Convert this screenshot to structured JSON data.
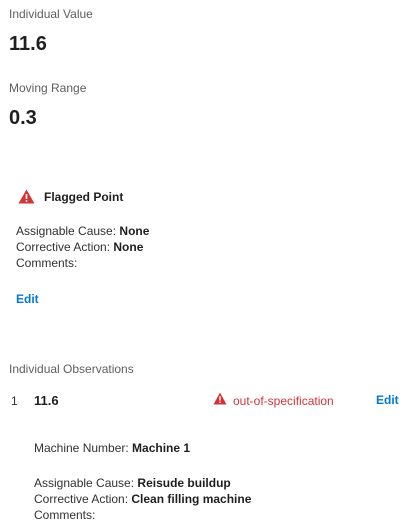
{
  "summary": {
    "individual_value_label": "Individual Value",
    "individual_value": "11.6",
    "moving_range_label": "Moving Range",
    "moving_range": "0.3"
  },
  "flagged": {
    "title": "Flagged Point",
    "icon": "warning-icon",
    "assignable_cause_label": "Assignable Cause: ",
    "assignable_cause": "None",
    "corrective_action_label": "Corrective Action: ",
    "corrective_action": "None",
    "comments_label": "Comments:",
    "edit_label": "Edit"
  },
  "observations": {
    "header": "Individual Observations",
    "items": [
      {
        "index": "1",
        "value": "11.6",
        "status": "out-of-specification",
        "status_icon": "warning-icon",
        "edit_label": "Edit",
        "machine_number_label": "Machine Number: ",
        "machine_number": "Machine 1",
        "assignable_cause_label": "Assignable Cause: ",
        "assignable_cause": "Reisude buildup",
        "corrective_action_label": "Corrective Action: ",
        "corrective_action": "Clean filling machine",
        "comments_label": "Comments:"
      }
    ]
  },
  "colors": {
    "warning": "#d13438",
    "link": "#0078d4"
  }
}
